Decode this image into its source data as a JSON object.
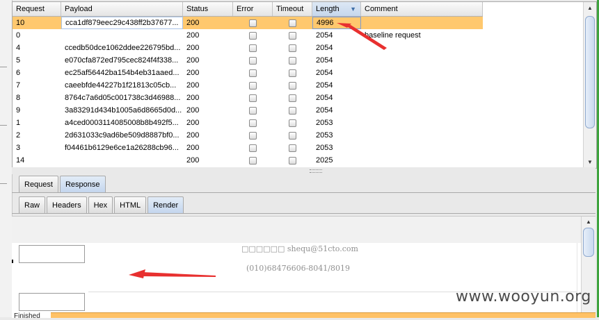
{
  "table": {
    "columns": [
      {
        "label": "Request"
      },
      {
        "label": "Payload"
      },
      {
        "label": "Status"
      },
      {
        "label": "Error"
      },
      {
        "label": "Timeout"
      },
      {
        "label": "Length"
      },
      {
        "label": "Comment"
      }
    ],
    "sorted_column": "Length",
    "sort_icon": "triangle-down-icon",
    "rows": [
      {
        "request": "10",
        "payload": "cca1df879eec29c438ff2b37677...",
        "status": "200",
        "error": false,
        "timeout": false,
        "length": "4996",
        "comment": "",
        "selected": true
      },
      {
        "request": "0",
        "payload": "",
        "status": "200",
        "error": false,
        "timeout": false,
        "length": "2054",
        "comment": "baseline request",
        "selected": false
      },
      {
        "request": "4",
        "payload": "ccedb50dce1062ddee226795bd...",
        "status": "200",
        "error": false,
        "timeout": false,
        "length": "2054",
        "comment": "",
        "selected": false
      },
      {
        "request": "5",
        "payload": "e070cfa872ed795cec824f4f338...",
        "status": "200",
        "error": false,
        "timeout": false,
        "length": "2054",
        "comment": "",
        "selected": false
      },
      {
        "request": "6",
        "payload": "ec25af56442ba154b4eb31aaed...",
        "status": "200",
        "error": false,
        "timeout": false,
        "length": "2054",
        "comment": "",
        "selected": false
      },
      {
        "request": "7",
        "payload": "caeebfde44227b1f21813c05cb...",
        "status": "200",
        "error": false,
        "timeout": false,
        "length": "2054",
        "comment": "",
        "selected": false
      },
      {
        "request": "8",
        "payload": "8764c7a6d05c001738c3d46988...",
        "status": "200",
        "error": false,
        "timeout": false,
        "length": "2054",
        "comment": "",
        "selected": false
      },
      {
        "request": "9",
        "payload": "3a83291d434b1005a6d8665d0d...",
        "status": "200",
        "error": false,
        "timeout": false,
        "length": "2054",
        "comment": "",
        "selected": false
      },
      {
        "request": "1",
        "payload": "a4ced0003114085008b8b492f5...",
        "status": "200",
        "error": false,
        "timeout": false,
        "length": "2053",
        "comment": "",
        "selected": false
      },
      {
        "request": "2",
        "payload": "2d631033c9ad6be509d8887bf0...",
        "status": "200",
        "error": false,
        "timeout": false,
        "length": "2053",
        "comment": "",
        "selected": false
      },
      {
        "request": "3",
        "payload": "f04461b6129e6ce1a26288cb96...",
        "status": "200",
        "error": false,
        "timeout": false,
        "length": "2053",
        "comment": "",
        "selected": false
      },
      {
        "request": "14",
        "payload": "",
        "status": "200",
        "error": false,
        "timeout": false,
        "length": "2025",
        "comment": "",
        "selected": false
      }
    ]
  },
  "message_tabs": [
    {
      "label": "Request",
      "active": false
    },
    {
      "label": "Response",
      "active": true
    }
  ],
  "view_tabs": [
    {
      "label": "Raw",
      "active": false
    },
    {
      "label": "Headers",
      "active": false
    },
    {
      "label": "Hex",
      "active": false
    },
    {
      "label": "HTML",
      "active": false
    },
    {
      "label": "Render",
      "active": true
    }
  ],
  "render": {
    "email_line": "□□□□□□ shequ@51cto.com",
    "phone_line": "(010)68476606-8041/8019"
  },
  "status_bar": {
    "label": "Finished"
  },
  "watermark": "www.wooyun.org",
  "colors": {
    "selected_row": "#ffc86e",
    "progress_fill": "#ffc266",
    "annotation_arrow": "#e8302f"
  }
}
